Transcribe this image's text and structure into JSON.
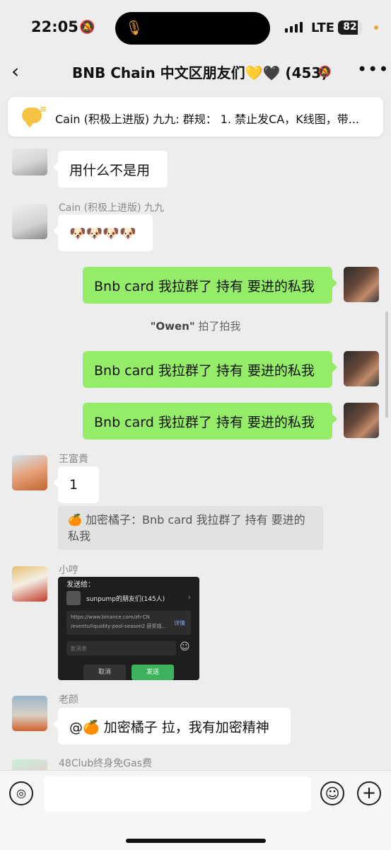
{
  "status": {
    "time": "22:05",
    "network": "LTE",
    "battery": "82",
    "battery_level": 0.82
  },
  "header": {
    "title": "BNB Chain 中文区朋友们💛🖤 (453)",
    "back_icon": "chevron-left-icon",
    "more_label": "•••"
  },
  "notice": {
    "text": "Cain (积极上进版) 九九: 群规： 1. 禁止发CA，K线图，带..."
  },
  "messages": {
    "m1": {
      "text": "用什么不是用"
    },
    "m2": {
      "sender": "Cain (积极上进版) 九九",
      "text": "🐶🐶🐶🐶"
    },
    "m3": {
      "text": "Bnb card 我拉群了 持有 要进的私我"
    },
    "sys": {
      "actor": "\"Owen\"",
      "action": " 拍了拍我"
    },
    "m4": {
      "text": "Bnb card 我拉群了 持有 要进的私我"
    },
    "m5": {
      "text": "Bnb card 我拉群了 持有 要进的私我"
    },
    "m6": {
      "sender": "王富貴",
      "text": "1",
      "quote": "🍊 加密橘子：Bnb card 我拉群了 持有 要进的私我"
    },
    "m7": {
      "sender": "小哼",
      "image": {
        "send_to": "发送给：",
        "group": "sunpump的朋友们(145人)",
        "url_line1": "https://www.binance.com/zh-CN",
        "url_line2": "/events/liquidity-pool-season2 获奖规...",
        "details": "详情",
        "placeholder": "发消息",
        "cancel": "取消",
        "send": "发送"
      }
    },
    "m8": {
      "sender": "老颜",
      "text": "@🍊 加密橘子 拉，我有加密精神"
    },
    "m9": {
      "sender": "48Club终身免Gas费"
    }
  },
  "input": {
    "value": ""
  },
  "colors": {
    "outgoing_bubble": "#95ec69",
    "background": "#ededed",
    "accent": "#f5c242"
  }
}
